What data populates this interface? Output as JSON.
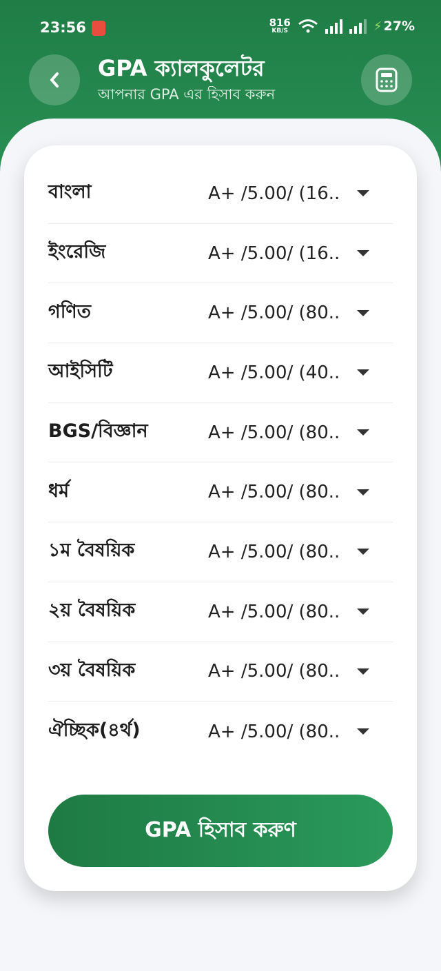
{
  "status_bar": {
    "time": "23:56",
    "net_speed": "816",
    "net_unit": "KB/S",
    "battery": "27%"
  },
  "header": {
    "title": "GPA ক্যালকুলেটর",
    "subtitle": "আপনার GPA এর হিসাব করুন",
    "back_icon": "chevron-left-icon",
    "calculator_icon": "calculator-icon"
  },
  "subjects": [
    {
      "name": "বাংলা",
      "grade": "A+ /5.00/ (16.."
    },
    {
      "name": "ইংরেজি",
      "grade": "A+ /5.00/ (16.."
    },
    {
      "name": "গণিত",
      "grade": "A+ /5.00/ (80.."
    },
    {
      "name": "আইসিটি",
      "grade": "A+ /5.00/ (40.."
    },
    {
      "name": "BGS/বিজ্ঞান",
      "grade": "A+ /5.00/ (80.."
    },
    {
      "name": "ধর্ম",
      "grade": "A+ /5.00/ (80.."
    },
    {
      "name": "১ম বৈষয়িক",
      "grade": "A+ /5.00/ (80.."
    },
    {
      "name": "২য় বৈষয়িক",
      "grade": "A+ /5.00/ (80.."
    },
    {
      "name": "৩য় বৈষয়িক",
      "grade": "A+ /5.00/ (80.."
    },
    {
      "name": "ঐচ্ছিক(৪র্থ)",
      "grade": "A+ /5.00/ (80.."
    }
  ],
  "action": {
    "label": "GPA হিসাব করুণ"
  },
  "colors": {
    "primary": "#1f7d45",
    "accent": "#2a9a5b"
  }
}
